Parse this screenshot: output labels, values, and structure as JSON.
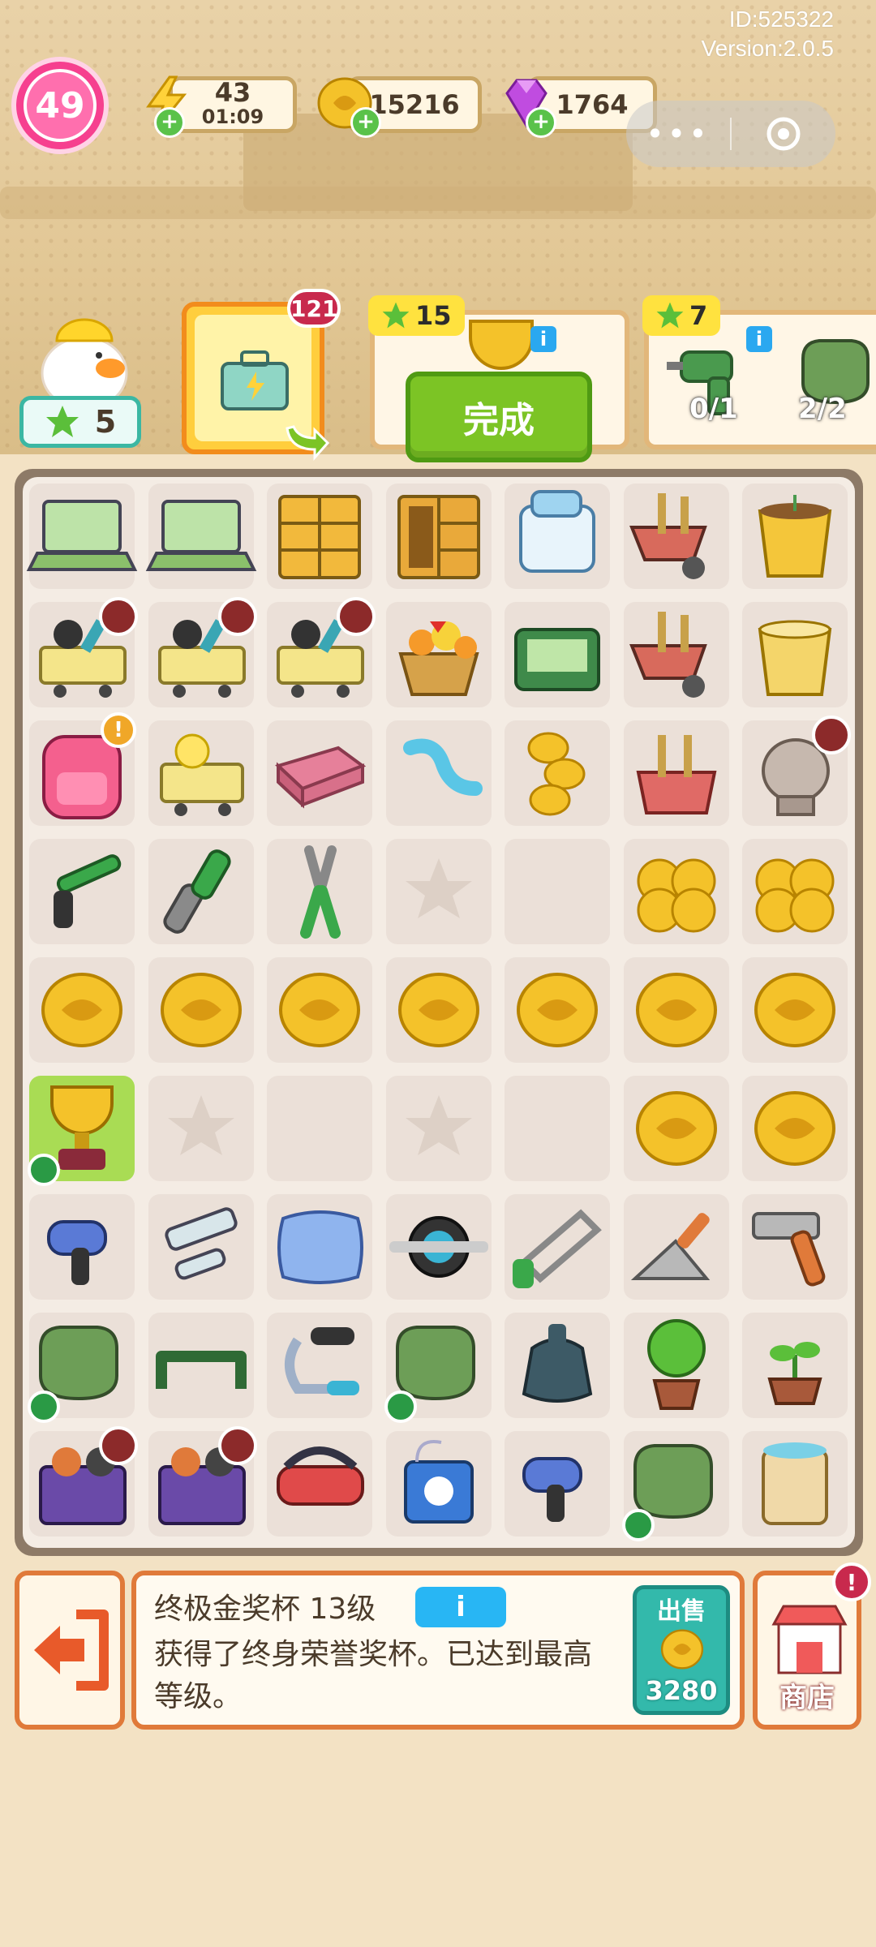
{
  "header": {
    "user_id": "ID:525322",
    "version": "Version:2.0.5",
    "level": "49"
  },
  "resources": {
    "energy": {
      "value": "43",
      "timer": "01:09",
      "icon": "lightning-icon"
    },
    "coins": {
      "value": "15216",
      "icon": "coin-icon"
    },
    "gems": {
      "value": "1764",
      "icon": "gem-icon"
    }
  },
  "miniprogram": {
    "menu_icon": "more-dots-icon",
    "close_icon": "target-icon"
  },
  "player": {
    "stars": "5"
  },
  "box_card": {
    "count": "121",
    "icon": "toolbox-icon"
  },
  "orders": [
    {
      "reward_stars": "15",
      "item": "trophy-icon",
      "button": "完成"
    },
    {
      "reward_stars": "7",
      "items": [
        {
          "icon": "drill-icon",
          "progress": "0/1"
        },
        {
          "icon": "gloves-icon",
          "progress": "2/2"
        }
      ]
    }
  ],
  "board": {
    "rows": [
      [
        "laptop",
        "laptop",
        "cabinet",
        "cabinet-open",
        "washer",
        "wheelbarrow-tools",
        "bucket-plant"
      ],
      [
        "cart-tools",
        "cart-tools",
        "cart-tools",
        "flower-basket",
        "toolbox-green",
        "wheelbarrow-tools",
        "bucket-empty"
      ],
      [
        "pink-backpack",
        "cart-duck",
        "brick",
        "blue-ribbon",
        "coin-stack",
        "tool-basket",
        "stone-statue"
      ],
      [
        "wrench-l",
        "adjustable-wrench",
        "pliers",
        "empty-star",
        "empty",
        "coin-pile",
        "coin-pile"
      ],
      [
        "coin",
        "coin",
        "coin",
        "coin",
        "coin",
        "coin",
        "coin"
      ],
      [
        "trophy",
        "empty-star",
        "empty",
        "empty-star",
        "empty",
        "coin",
        "coin"
      ],
      [
        "hair-dryer",
        "roller-tool",
        "pillow",
        "ab-wheel",
        "hacksaw",
        "trowel",
        "hammer"
      ],
      [
        "gloves",
        "grip-handle",
        "hand-gripper",
        "gloves",
        "water-bag",
        "potted-tree",
        "sprout"
      ],
      [
        "toy-box",
        "toy-box",
        "vr-headset",
        "cd-player",
        "hair-dryer",
        "gloves",
        "paint-can"
      ]
    ]
  },
  "bottom": {
    "back_icon": "exit-door-icon",
    "item_title": "终极金奖杯 13级",
    "info_button": "i",
    "item_desc": "获得了终身荣誉奖杯。已达到最高等级。",
    "sell_label": "出售",
    "sell_price": "3280",
    "shop_label": "商店"
  }
}
